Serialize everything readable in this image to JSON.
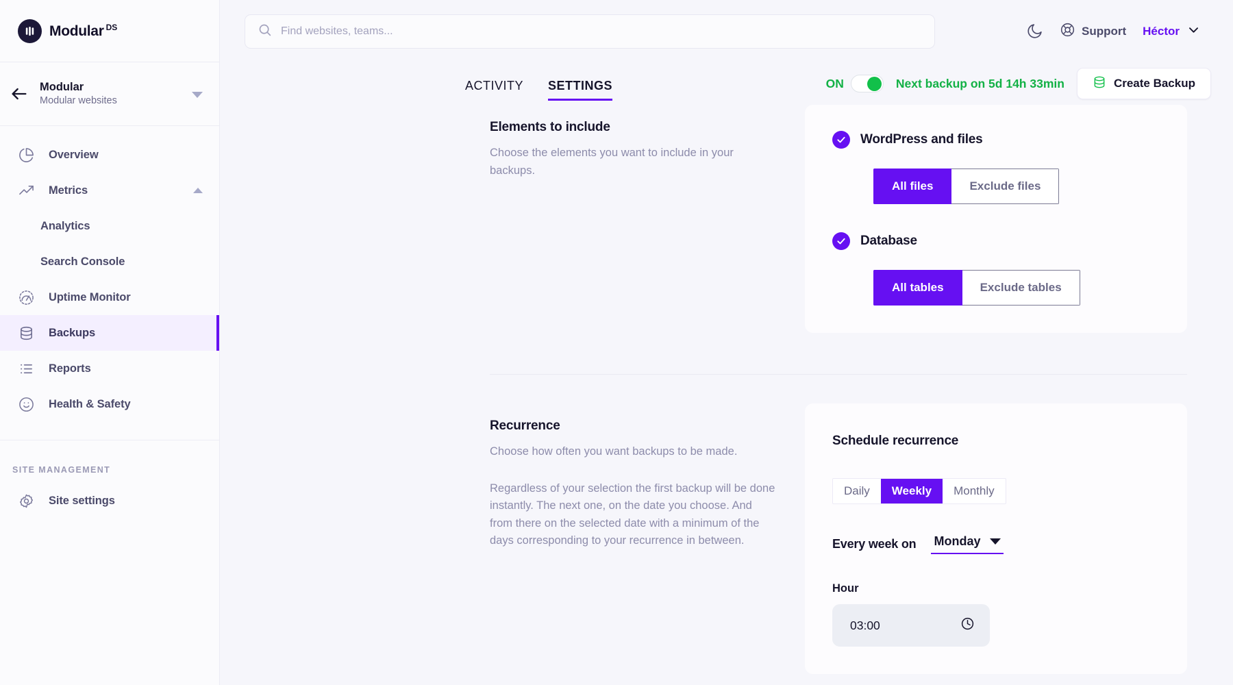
{
  "brand": {
    "name": "Modular",
    "superscript": "DS"
  },
  "site_switch": {
    "name": "Modular",
    "subtitle": "Modular websites"
  },
  "sidebar": {
    "items": [
      {
        "label": "Overview",
        "icon": "pie-chart-icon"
      },
      {
        "label": "Metrics",
        "icon": "trending-up-icon"
      },
      {
        "label": "Analytics",
        "icon": ""
      },
      {
        "label": "Search Console",
        "icon": ""
      },
      {
        "label": "Uptime Monitor",
        "icon": "gauge-icon"
      },
      {
        "label": "Backups",
        "icon": "database-icon"
      },
      {
        "label": "Reports",
        "icon": "list-icon"
      },
      {
        "label": "Health & Safety",
        "icon": "smiley-icon"
      }
    ],
    "section_label": "SITE MANAGEMENT",
    "site_settings": {
      "label": "Site settings",
      "icon": "gear-icon"
    }
  },
  "search": {
    "placeholder": "Find websites, teams...",
    "value": ""
  },
  "header": {
    "dark_mode_icon": "moon-icon",
    "support_label": "Support",
    "support_icon": "lifebuoy-icon",
    "user_name": "Héctor",
    "user_caret_icon": "chevron-down-icon"
  },
  "tabs": [
    {
      "label": "ACTIVITY",
      "active": false
    },
    {
      "label": "SETTINGS",
      "active": true
    }
  ],
  "backup_bar": {
    "toggle_label": "ON",
    "toggle_state": "on",
    "next_backup": "Next backup on 5d 14h 33min",
    "create_button": "Create Backup",
    "create_button_icon": "database-icon",
    "accent_green": "#12b145"
  },
  "elements_section": {
    "title": "Elements to include",
    "description": "Choose the elements you want to include in your backups.",
    "groups": [
      {
        "title": "WordPress and files",
        "checked": true,
        "options": [
          {
            "label": "All files",
            "active": true
          },
          {
            "label": "Exclude files",
            "active": false
          }
        ]
      },
      {
        "title": "Database",
        "checked": true,
        "options": [
          {
            "label": "All tables",
            "active": true
          },
          {
            "label": "Exclude tables",
            "active": false
          }
        ]
      }
    ]
  },
  "recurrence_section": {
    "title": "Recurrence",
    "description_1": "Choose how often you want backups to be made.",
    "description_2": "Regardless of your selection the first backup will be done instantly. The next one, on the date you choose. And from there on the selected date with a minimum of the days corresponding to your recurrence in between.",
    "card_title": "Schedule recurrence",
    "frequencies": [
      {
        "label": "Daily",
        "active": false
      },
      {
        "label": "Weekly",
        "active": true
      },
      {
        "label": "Monthly",
        "active": false
      }
    ],
    "weekday_label": "Every week on",
    "weekday_value": "Monday",
    "hour_label": "Hour",
    "hour_value": "03:00",
    "hour_icon": "clock-icon"
  },
  "colors": {
    "accent_purple": "#6610f2",
    "accent_green": "#12b145",
    "page_bg": "#f6f6fb",
    "card_bg": "#fdfcfe"
  }
}
